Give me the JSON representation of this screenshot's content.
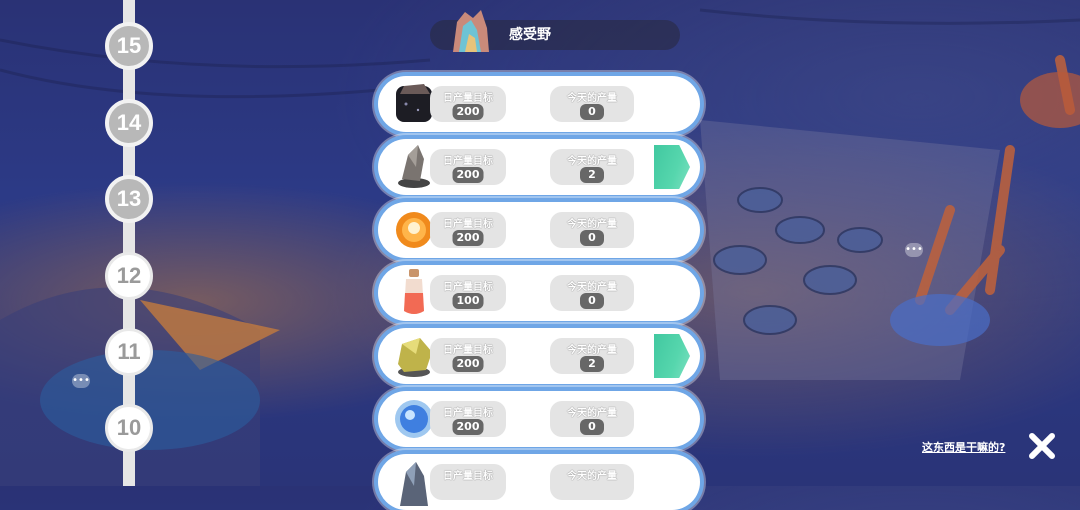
{
  "title": "感受野",
  "levels": [
    "15",
    "14",
    "13",
    "12",
    "11",
    "10"
  ],
  "labels": {
    "target": "日产量目标",
    "today": "今天的产量"
  },
  "rows": [
    {
      "icon": "black-ore-icon",
      "target": "200",
      "today": "0",
      "progress": 0
    },
    {
      "icon": "gray-crystal-icon",
      "target": "200",
      "today": "2",
      "progress": 0.01
    },
    {
      "icon": "orange-ball-icon",
      "target": "200",
      "today": "0",
      "progress": 0
    },
    {
      "icon": "potion-bottle-icon",
      "target": "100",
      "today": "0",
      "progress": 0
    },
    {
      "icon": "yellow-ore-icon",
      "target": "200",
      "today": "2",
      "progress": 0.01
    },
    {
      "icon": "blue-orb-icon",
      "target": "200",
      "today": "0",
      "progress": 0
    },
    {
      "icon": "dark-crystal-icon",
      "target": "",
      "today": "",
      "progress": 0
    }
  ],
  "help_text": "这东西是干嘛的?",
  "colors": {
    "row_border": "#6fa6e6",
    "progress": "#4fd0a6",
    "value_badge": "#676767"
  }
}
